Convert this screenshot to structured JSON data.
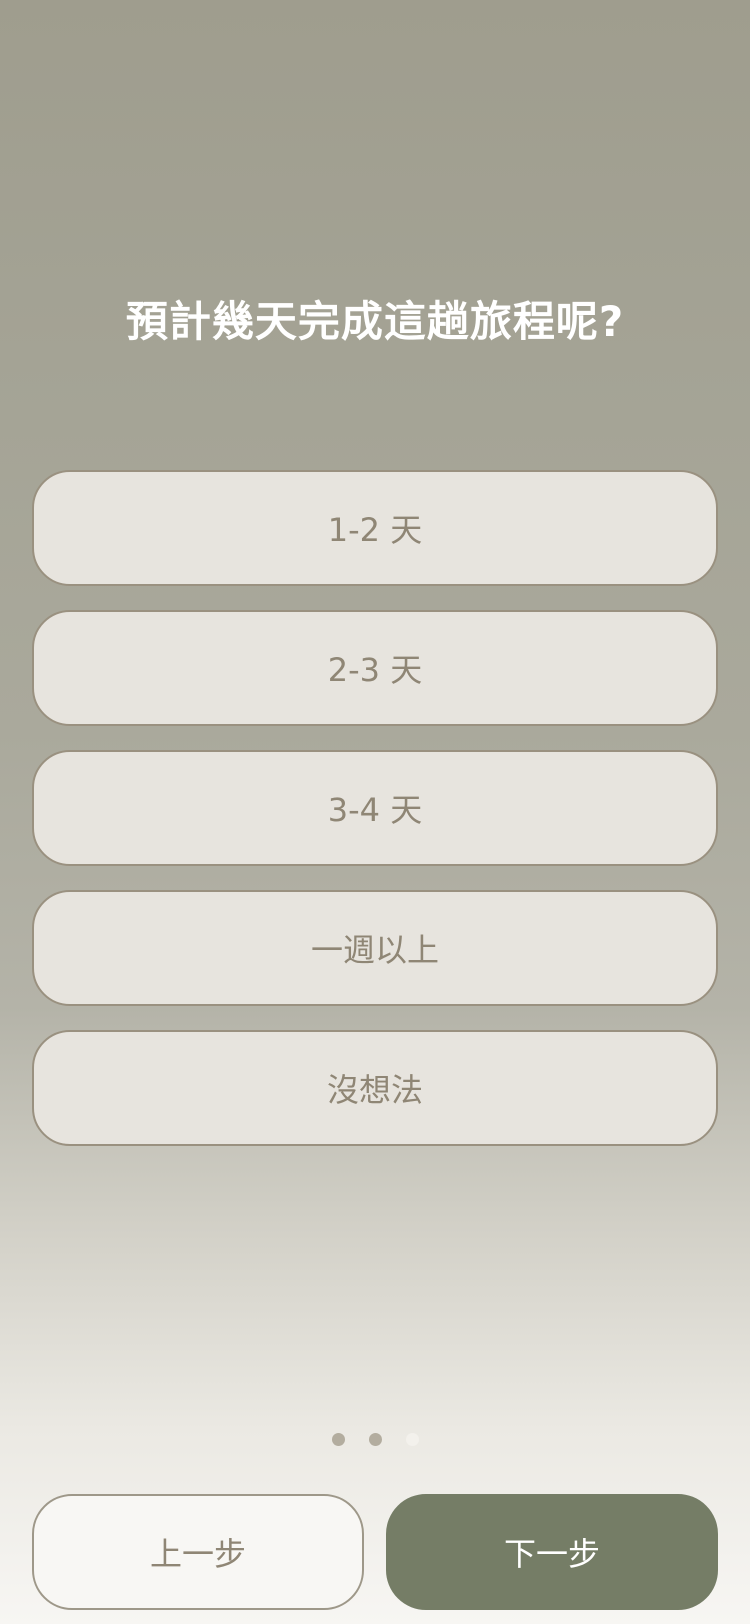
{
  "question": "預計幾天完成這趟旅程呢?",
  "options": [
    {
      "label": "1-2 天"
    },
    {
      "label": "2-3 天"
    },
    {
      "label": "3-4 天"
    },
    {
      "label": "一週以上"
    },
    {
      "label": "沒想法"
    }
  ],
  "pagination": {
    "total": 3,
    "current": 3,
    "colors": {
      "inactive": "#b3ad9f",
      "active": "#f3f1ec"
    }
  },
  "nav": {
    "prev_label": "上一步",
    "next_label": "下一步"
  },
  "colors": {
    "accent": "#757d66",
    "option_bg": "#e7e4de",
    "option_border": "#9a9180",
    "option_text": "#8f8675"
  }
}
